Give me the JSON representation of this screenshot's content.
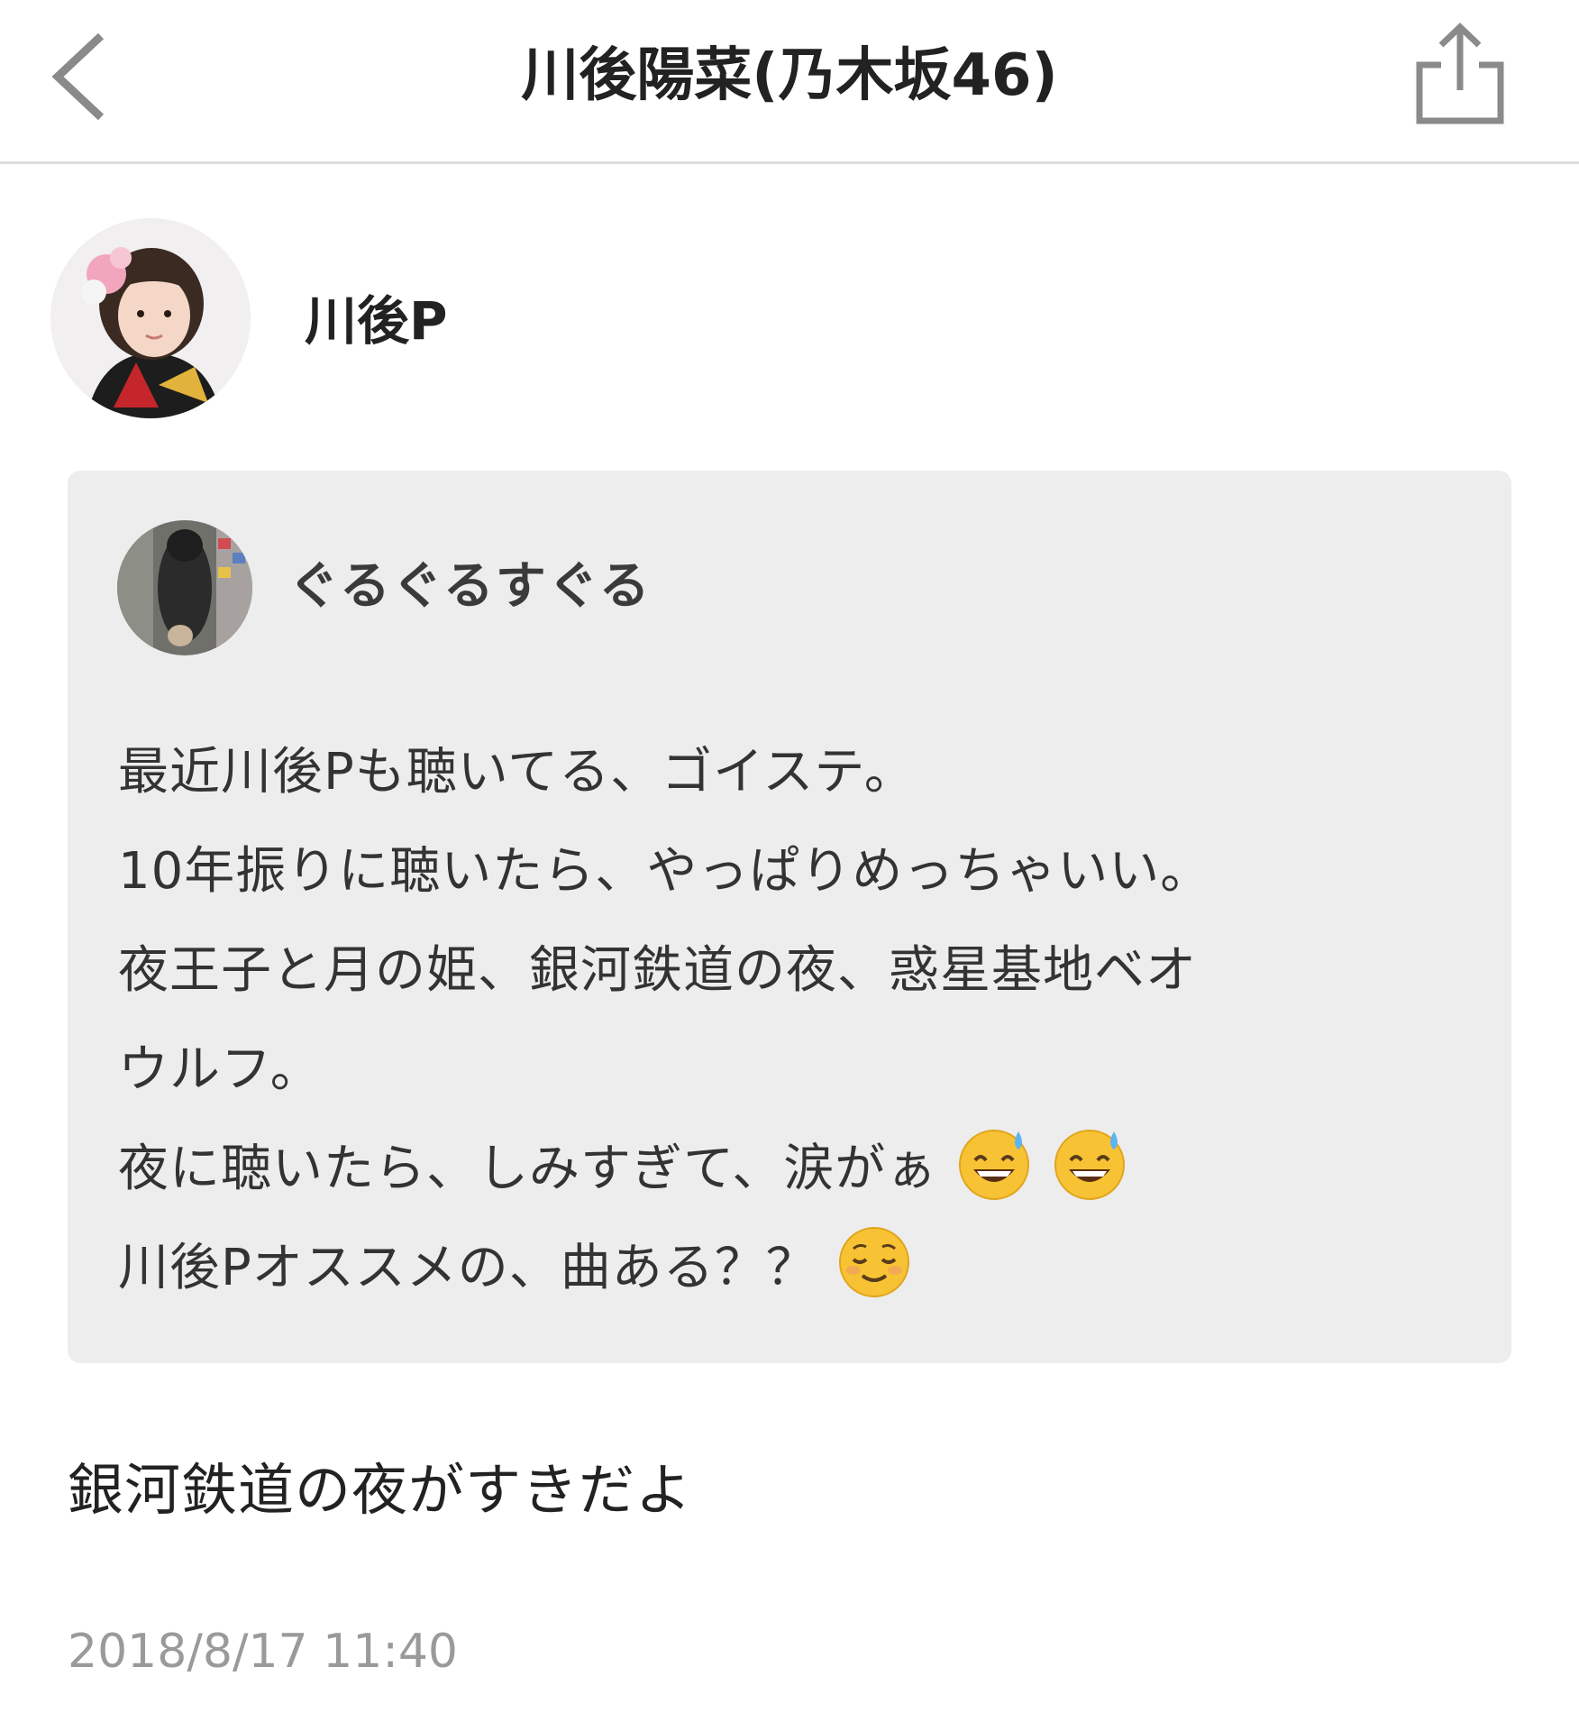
{
  "header": {
    "title": "川後陽菜(乃木坂46)",
    "back_icon": "chevron-left-icon",
    "share_icon": "share-icon"
  },
  "post": {
    "author_name": "川後P",
    "quote": {
      "author_name": "ぐるぐるすぐる",
      "lines": [
        "最近川後Pも聴いてる、ゴイステ。",
        "10年振りに聴いたら、やっぱりめっちゃいい。",
        "夜王子と月の姫、銀河鉄道の夜、惑星基地ベオ",
        "ウルフ。",
        "夜に聴いたら、しみすぎて、涙がぁ",
        "川後Pオススメの、曲ある？？"
      ],
      "emojis": {
        "line5": [
          "grinning-sweat-emoji",
          "grinning-sweat-emoji"
        ],
        "line6": [
          "relieved-face-emoji"
        ]
      }
    },
    "reply_text": "銀河鉄道の夜がすきだよ",
    "timestamp": "2018/8/17 11:40"
  },
  "colors": {
    "card_background": "#ededed",
    "divider": "#dcdcdc",
    "timestamp": "#9a9a9a",
    "icon_gray": "#8a8a8a"
  }
}
